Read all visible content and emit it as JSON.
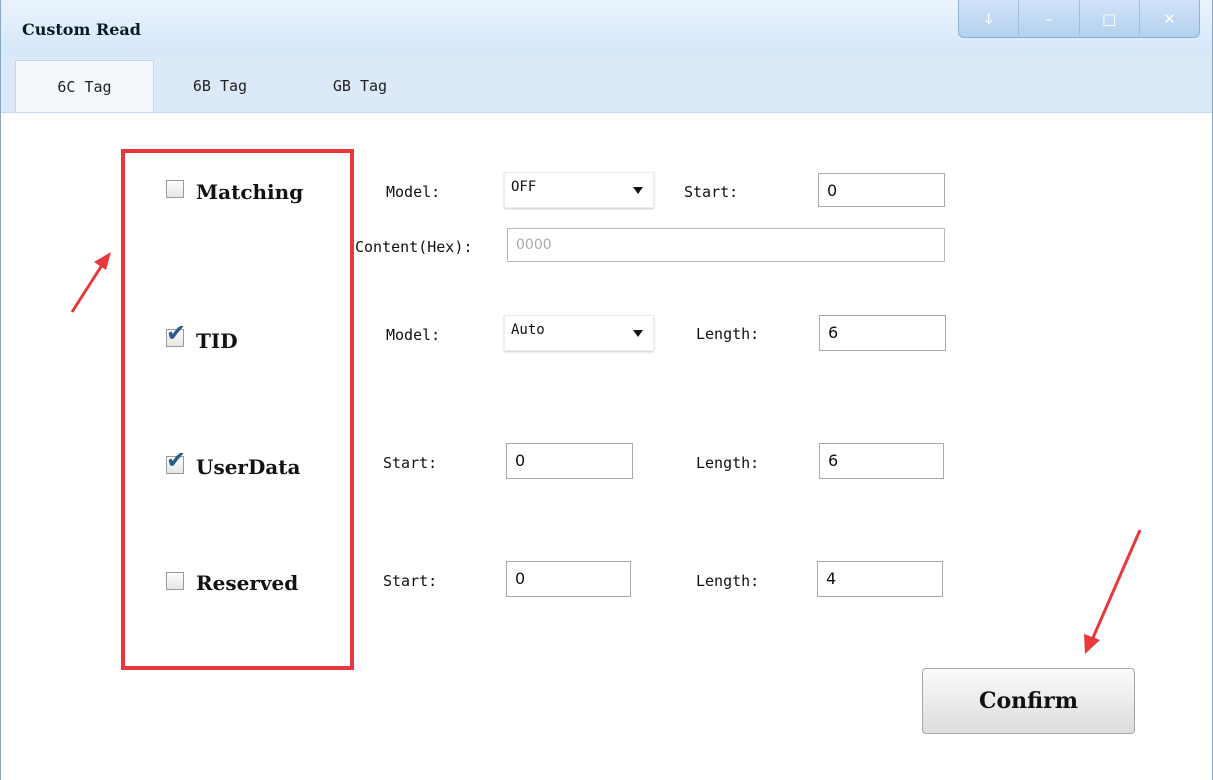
{
  "window": {
    "title": "Custom Read",
    "controls": {
      "menu": "↓",
      "minimize": "–",
      "maximize": "□",
      "close": "✕"
    }
  },
  "tabs": [
    {
      "label": "6C Tag",
      "active": true
    },
    {
      "label": "6B Tag",
      "active": false
    },
    {
      "label": "GB Tag",
      "active": false
    }
  ],
  "rows": {
    "matching": {
      "label": "Matching",
      "checked": false,
      "model_label": "Model:",
      "model_value": "OFF",
      "start_label": "Start:",
      "start_value": "0",
      "content_label": "Content(Hex):",
      "content_value": "0000"
    },
    "tid": {
      "label": "TID",
      "checked": true,
      "model_label": "Model:",
      "model_value": "Auto",
      "length_label": "Length:",
      "length_value": "6"
    },
    "userdata": {
      "label": "UserData",
      "checked": true,
      "start_label": "Start:",
      "start_value": "0",
      "length_label": "Length:",
      "length_value": "6"
    },
    "reserved": {
      "label": "Reserved",
      "checked": false,
      "start_label": "Start:",
      "start_value": "0",
      "length_label": "Length:",
      "length_value": "4"
    }
  },
  "confirm_label": "Confirm",
  "colors": {
    "highlight": "#e8383d",
    "accent": "#dbe9f8"
  }
}
